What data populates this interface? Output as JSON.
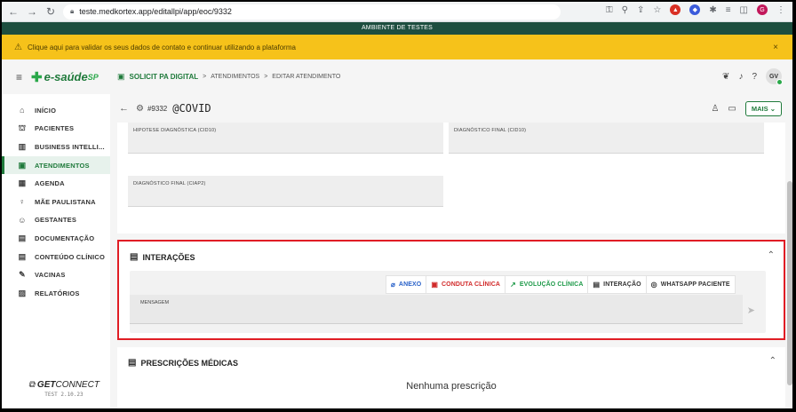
{
  "browser": {
    "url": "teste.medkortex.app/editallpi/app/eoc/9332",
    "profile_initial": "G"
  },
  "environment_banner": "AMBIENTE DE TESTES",
  "warning": {
    "text": "Clique aqui para validar os seus dados de contato e continuar utilizando a plataforma",
    "close": "×"
  },
  "header": {
    "logo_text": "e-saúde",
    "logo_suffix": "SP",
    "breadcrumb": {
      "root": "SOLICIT PA DIGITAL",
      "sep1": ">",
      "level2": "ATENDIMENTOS",
      "sep2": ">",
      "level3": "EDITAR ATENDIMENTO"
    },
    "avatar_initials": "GV"
  },
  "sidebar": {
    "items": [
      {
        "label": "INÍCIO",
        "icon": "home-icon",
        "glyph": "⌂"
      },
      {
        "label": "PACIENTES",
        "icon": "users-icon",
        "glyph": "⛫"
      },
      {
        "label": "BUSINESS INTELLI...",
        "icon": "chart-icon",
        "glyph": "▥"
      },
      {
        "label": "ATENDIMENTOS",
        "icon": "clipboard-icon",
        "glyph": "▣"
      },
      {
        "label": "AGENDA",
        "icon": "calendar-icon",
        "glyph": "▦"
      },
      {
        "label": "MÃE PAULISTANA",
        "icon": "pregnant-icon",
        "glyph": "♀"
      },
      {
        "label": "GESTANTES",
        "icon": "baby-icon",
        "glyph": "☺"
      },
      {
        "label": "DOCUMENTAÇÃO",
        "icon": "document-icon",
        "glyph": "▤"
      },
      {
        "label": "CONTEÚDO CLÍNICO",
        "icon": "book-icon",
        "glyph": "▤"
      },
      {
        "label": "VACINAS",
        "icon": "syringe-icon",
        "glyph": "✎"
      },
      {
        "label": "RELATÓRIOS",
        "icon": "report-icon",
        "glyph": "▨"
      }
    ],
    "active_index": 3,
    "brand_get": "GET",
    "brand_connect": "CONNECT",
    "version": "TEST 2.10.23"
  },
  "page": {
    "id": "#9332",
    "title": "@COVID",
    "more_button": "MAIS",
    "fields": {
      "hipotese": "HIPOTESE DIAGNÓSTICA (CID10)",
      "diag_final_cid": "DIAGNÓSTICO FINAL (CID10)",
      "diag_final_ciap": "DIAGNÓSTICO FINAL (CIAP2)"
    },
    "interacoes": {
      "title": "INTERAÇÕES",
      "tabs": [
        {
          "label": "ANEXO",
          "icon": "paperclip-icon",
          "glyph": "⌀",
          "cls": "t-anexo"
        },
        {
          "label": "CONDUTA CLÍNICA",
          "icon": "clipboard-icon",
          "glyph": "▣",
          "cls": "t-conduta"
        },
        {
          "label": "EVOLUÇÃO CLÍNICA",
          "icon": "trend-icon",
          "glyph": "↗",
          "cls": "t-evol"
        },
        {
          "label": "INTERAÇÃO",
          "icon": "chat-icon",
          "glyph": "▤",
          "cls": "t-inter"
        },
        {
          "label": "WHATSAPP PACIENTE",
          "icon": "whatsapp-icon",
          "glyph": "◎",
          "cls": "t-whats"
        }
      ],
      "message_label": "MENSAGEM"
    },
    "prescricoes": {
      "title": "PRESCRIÇÕES MÉDICAS",
      "empty": "Nenhuma prescrição"
    }
  },
  "colors": {
    "brand_green": "#1f7a3b",
    "highlight_red": "#e01d25",
    "warning_yellow": "#f6c21a"
  }
}
